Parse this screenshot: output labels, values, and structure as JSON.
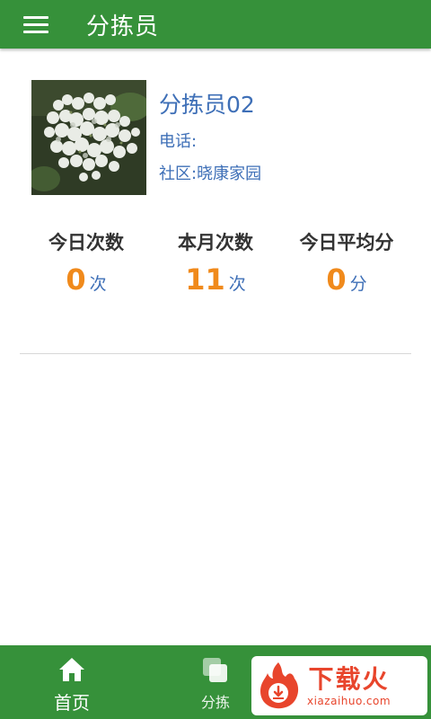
{
  "header": {
    "title": "分拣员",
    "menu_icon": "hamburger-menu-icon"
  },
  "profile": {
    "avatar": "white-lilac-flowers-photo",
    "name": "分拣员02",
    "phone_label": "电话:",
    "phone_value": "",
    "community_label": "社区:",
    "community_value": "晓康家园"
  },
  "stats": [
    {
      "label": "今日次数",
      "value": "0",
      "unit": "次"
    },
    {
      "label": "本月次数",
      "value": "11",
      "unit": "次"
    },
    {
      "label": "今日平均分",
      "value": "0",
      "unit": "分"
    }
  ],
  "bottom_nav": {
    "items": [
      {
        "label": "首页",
        "icon": "home-icon"
      },
      {
        "label": "分拣",
        "icon": "layers-icon"
      },
      {
        "label": "",
        "icon": "document-icon"
      }
    ]
  },
  "watermark": {
    "title": "下载火",
    "url": "xiazaihuo.com"
  },
  "colors": {
    "primary": "#36913a",
    "accent_value": "#f08a1c",
    "link_text": "#3e6fb7",
    "watermark": "#e8452c"
  }
}
